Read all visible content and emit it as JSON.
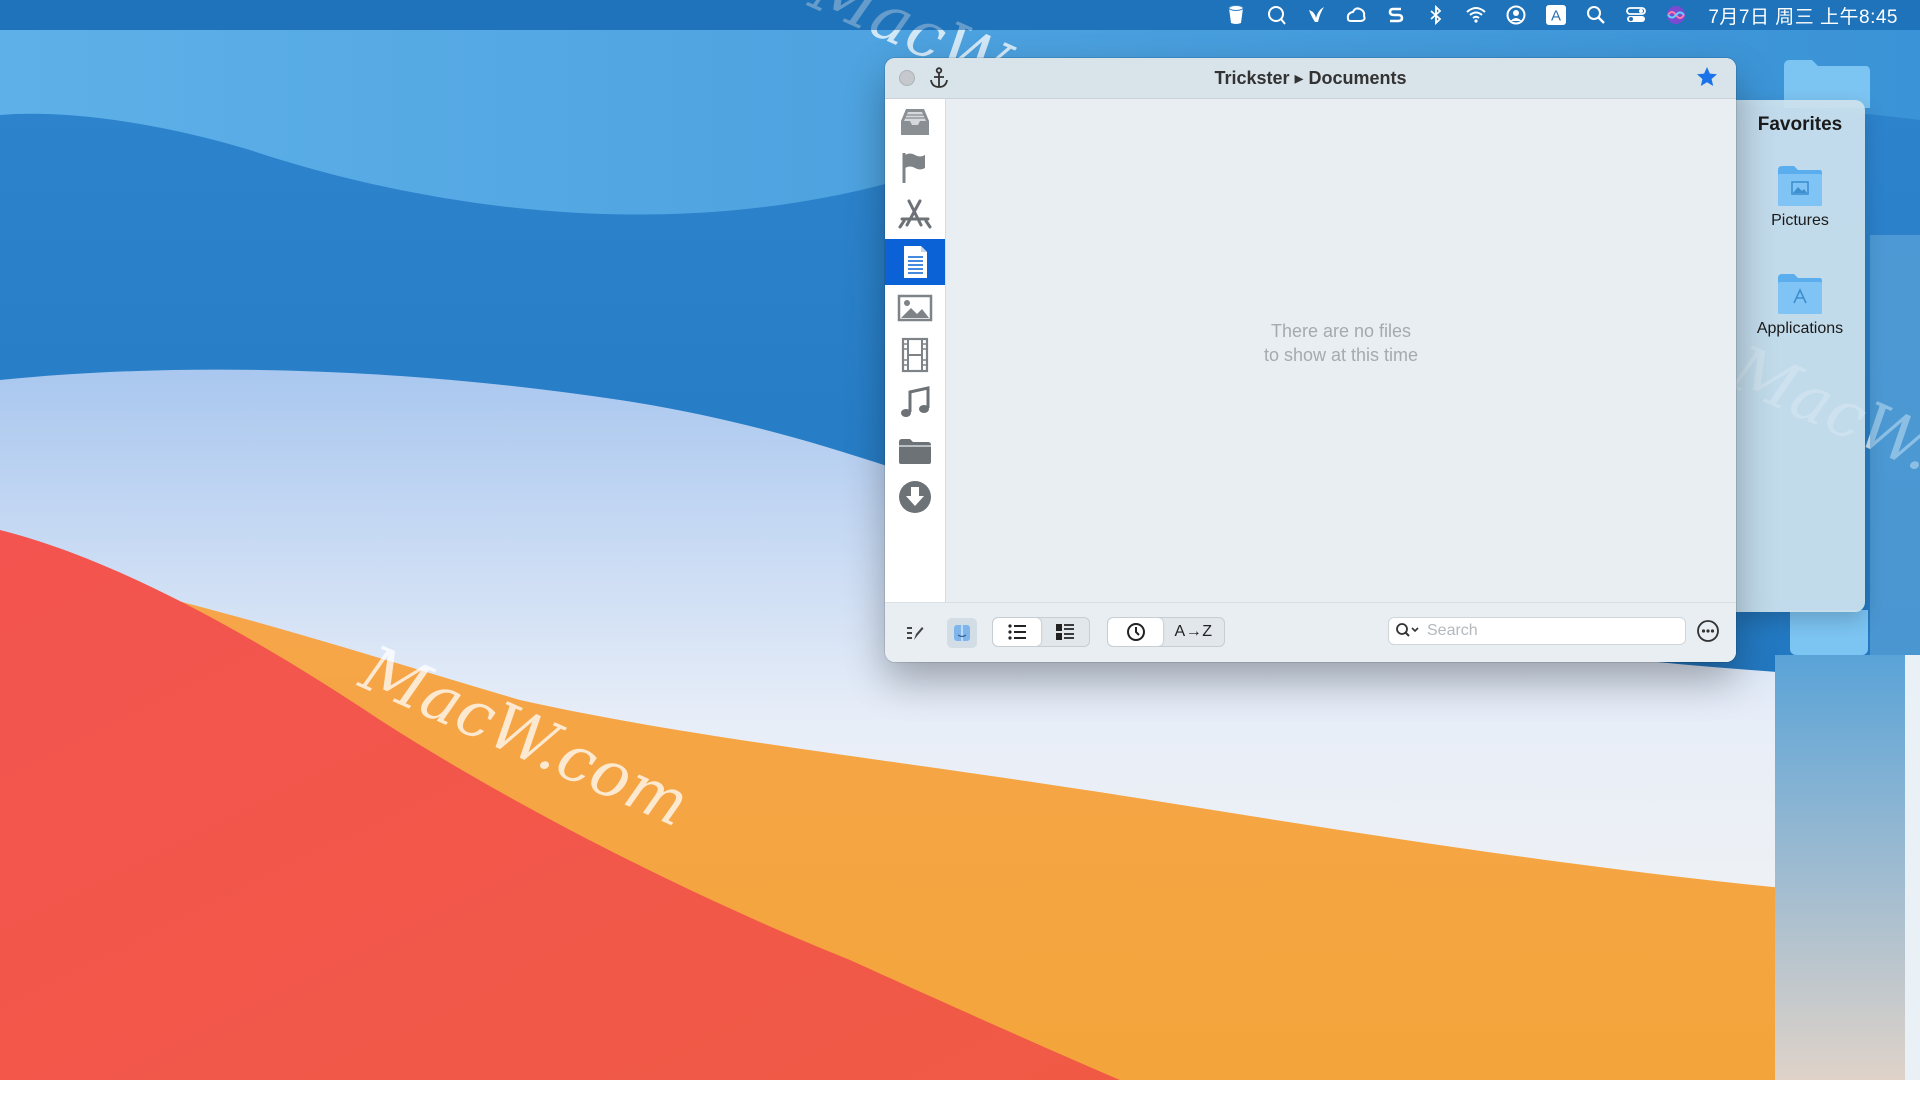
{
  "menubar": {
    "clock": "7月7日 周三 上午8:45",
    "icons": [
      "cloud-storage-icon",
      "chat-icon",
      "bird-icon",
      "creative-cloud-icon",
      "s-logo-icon",
      "bluetooth-icon",
      "wifi-icon",
      "user-icon",
      "input-method-icon",
      "spotlight-search-icon",
      "control-center-icon",
      "siri-icon"
    ],
    "input_method_letter": "A"
  },
  "watermark": {
    "text": "MacW.com"
  },
  "window": {
    "title": "Trickster ▸ Documents",
    "empty_message": "There are no files\nto show at this time",
    "sidebar_items": [
      {
        "name": "inbox",
        "icon": "inbox-tray-icon",
        "selected": false
      },
      {
        "name": "flagged",
        "icon": "flag-icon",
        "selected": false
      },
      {
        "name": "applications",
        "icon": "app-store-icon",
        "selected": false
      },
      {
        "name": "documents",
        "icon": "document-icon",
        "selected": true
      },
      {
        "name": "pictures",
        "icon": "picture-icon",
        "selected": false
      },
      {
        "name": "movies",
        "icon": "film-icon",
        "selected": false
      },
      {
        "name": "music",
        "icon": "music-note-icon",
        "selected": false
      },
      {
        "name": "folders",
        "icon": "folder-icon",
        "selected": false
      },
      {
        "name": "downloads",
        "icon": "download-icon",
        "selected": false
      }
    ],
    "toolbar": {
      "sort_az_label": "A→Z",
      "search_placeholder": "Search"
    }
  },
  "favorites": {
    "title": "Favorites",
    "items": [
      {
        "label": "Pictures",
        "icon": "pictures-folder-icon"
      },
      {
        "label": "Applications",
        "icon": "applications-folder-icon"
      }
    ]
  },
  "colors": {
    "accent": "#0b62d6",
    "window_bg": "#e8eef1",
    "titlebar_bg": "#d9e4ea",
    "star": "#1a73e8"
  }
}
